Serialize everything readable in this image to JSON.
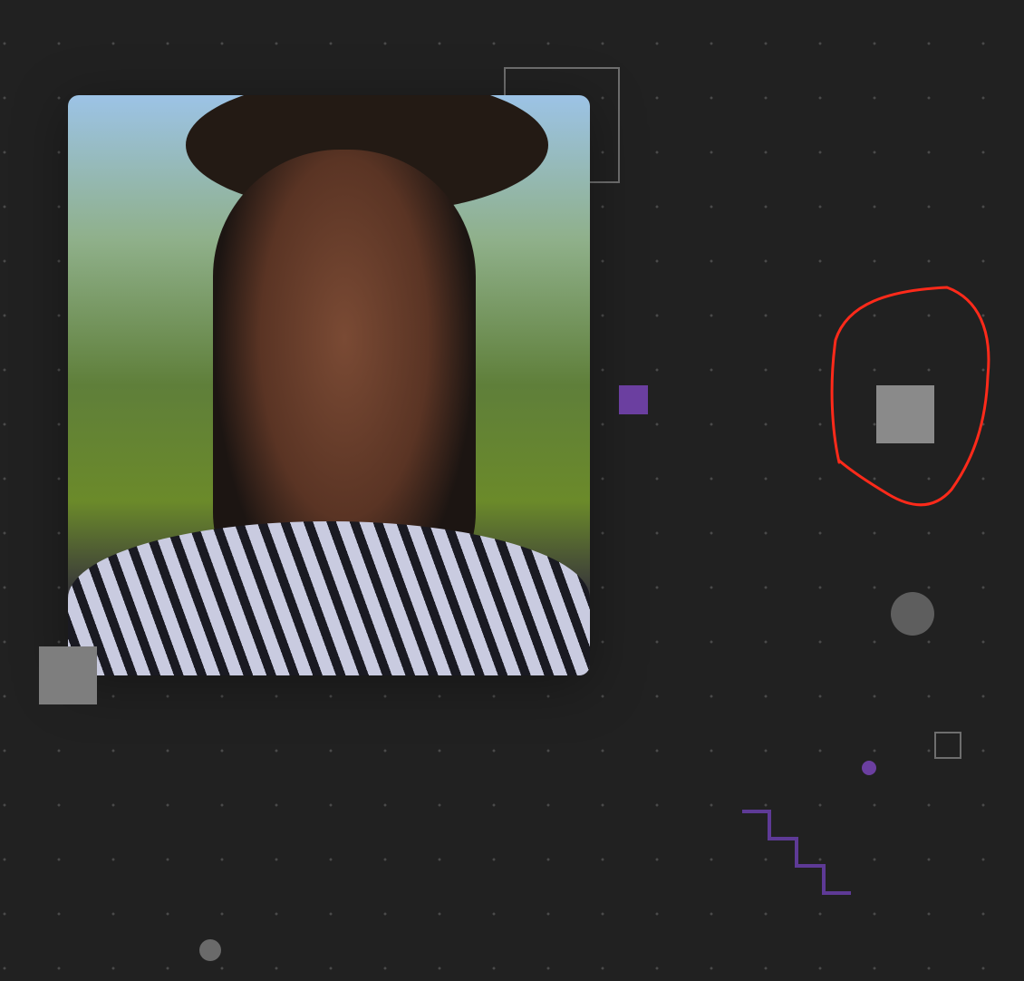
{
  "colors": {
    "background": "#212121",
    "accent_purple": "#6b3fa0",
    "gray_shape": "#8a8a8a",
    "annotation_red": "#ff2a1a"
  },
  "photo": {
    "subject": "portrait-photo"
  }
}
